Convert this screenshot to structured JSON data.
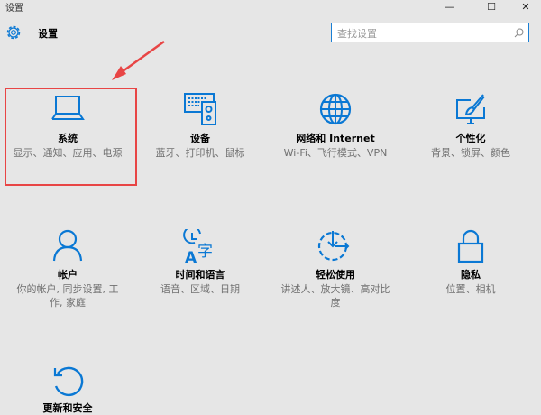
{
  "window": {
    "title": "设置",
    "minimize": "—",
    "maximize": "☐",
    "close": "✕"
  },
  "header": {
    "title": "设置",
    "search_placeholder": "查找设置"
  },
  "tiles": [
    {
      "title": "系统",
      "desc": "显示、通知、应用、电源",
      "icon": "laptop-icon"
    },
    {
      "title": "设备",
      "desc": "蓝牙、打印机、鼠标",
      "icon": "devices-icon"
    },
    {
      "title": "网络和 Internet",
      "desc": "Wi-Fi、飞行模式、VPN",
      "icon": "globe-icon"
    },
    {
      "title": "个性化",
      "desc": "背景、锁屏、颜色",
      "icon": "personalize-icon"
    },
    {
      "title": "帐户",
      "desc": "你的帐户, 同步设置, 工作, 家庭",
      "icon": "person-icon"
    },
    {
      "title": "时间和语言",
      "desc": "语音、区域、日期",
      "icon": "time-language-icon"
    },
    {
      "title": "轻松使用",
      "desc": "讲述人、放大镜、高对比度",
      "icon": "ease-of-access-icon"
    },
    {
      "title": "隐私",
      "desc": "位置、相机",
      "icon": "lock-icon"
    },
    {
      "title": "更新和安全",
      "desc": "",
      "icon": "update-icon"
    }
  ],
  "colors": {
    "accent": "#0a78d4",
    "highlight": "#e84545"
  }
}
